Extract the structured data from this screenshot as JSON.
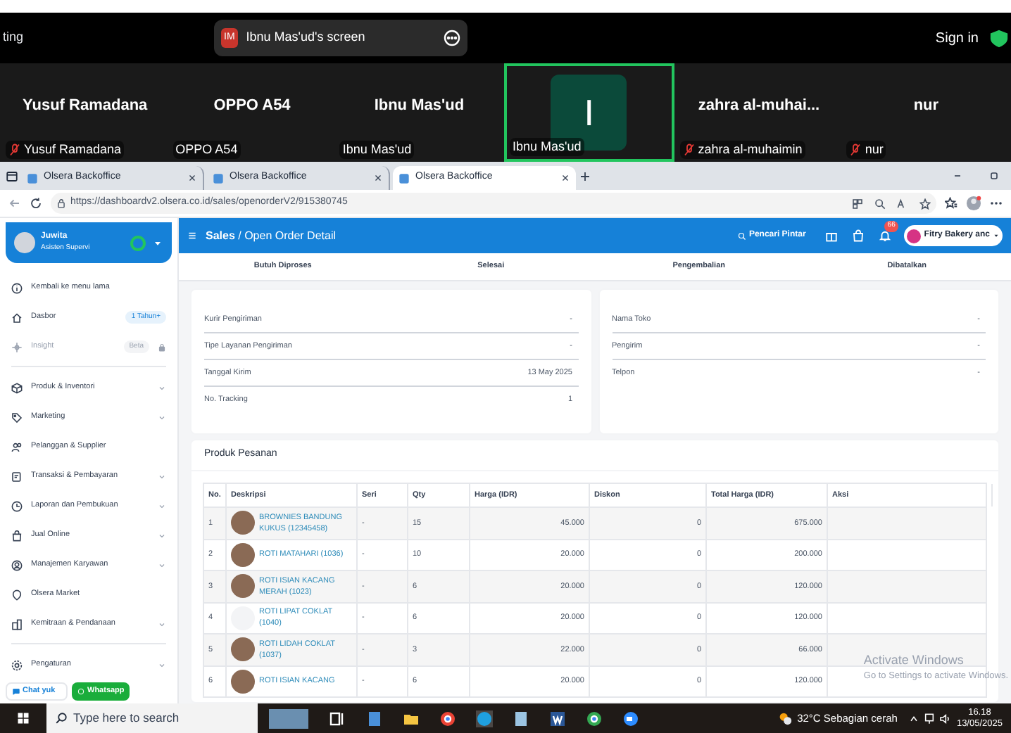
{
  "meeting_bar": {
    "left_text": "ting",
    "share_badge": "IM",
    "share_label": "Ibnu Mas'ud's screen",
    "sign_in": "Sign in"
  },
  "participants": [
    {
      "display_name": "Yusuf Ramadana",
      "label": "Yusuf Ramadana",
      "muted": true,
      "active_speaker": false
    },
    {
      "display_name": "OPPO A54",
      "label": "OPPO A54",
      "muted": false,
      "active_speaker": false
    },
    {
      "display_name": "Ibnu Mas'ud",
      "label": "Ibnu Mas'ud",
      "muted": false,
      "active_speaker": false
    },
    {
      "avatar": "I",
      "label": "Ibnu Mas'ud",
      "muted": false,
      "active_speaker": true
    },
    {
      "display_name": "zahra  al-muhai...",
      "label": "zahra al-muhaimin",
      "muted": true,
      "active_speaker": false
    },
    {
      "display_name": "nur",
      "label": "nur",
      "muted": true,
      "active_speaker": false
    }
  ],
  "browser": {
    "tabs": [
      {
        "title": "Olsera Backoffice",
        "selected": false
      },
      {
        "title": "Olsera Backoffice",
        "selected": false
      },
      {
        "title": "Olsera Backoffice",
        "selected": true
      }
    ],
    "url_host": "https://dashboardv2.olsera.co.id",
    "url_path": "/sales/openorderV2/915380745"
  },
  "sidebar": {
    "user": {
      "name": "Juwita",
      "role": "Asisten Supervi"
    },
    "items": [
      {
        "label": "Kembali ke menu lama",
        "has_submenu": false,
        "disabled": false
      },
      {
        "label": "Dasbor",
        "badge": "1 Tahun+",
        "has_submenu": false,
        "disabled": false
      },
      {
        "label": "Insight",
        "badge": "Beta",
        "has_submenu": false,
        "disabled": true
      },
      {
        "label": "Produk & Inventori",
        "has_submenu": true,
        "disabled": false
      },
      {
        "label": "Marketing",
        "has_submenu": true,
        "disabled": false
      },
      {
        "label": "Pelanggan & Supplier",
        "has_submenu": false,
        "disabled": false
      },
      {
        "label": "Transaksi & Pembayaran",
        "has_submenu": true,
        "disabled": false
      },
      {
        "label": "Laporan dan Pembukuan",
        "has_submenu": true,
        "disabled": false
      },
      {
        "label": "Jual Online",
        "has_submenu": true,
        "disabled": false
      },
      {
        "label": "Manajemen Karyawan",
        "has_submenu": true,
        "disabled": false
      },
      {
        "label": "Olsera Market",
        "has_submenu": false,
        "disabled": false
      },
      {
        "label": "Kemitraan & Pendanaan",
        "has_submenu": true,
        "disabled": false
      },
      {
        "label": "Pengaturan",
        "has_submenu": true,
        "disabled": false
      }
    ],
    "chat_button": "Chat yuk",
    "whatsapp_button": "Whatsapp"
  },
  "header": {
    "section": "Sales",
    "separator": "/",
    "page": "Open Order Detail",
    "search": "Pencari Pintar",
    "notification_count": "66",
    "store": "Fitry Bakery anc"
  },
  "status_tabs": [
    "Butuh Diproses",
    "Selesai",
    "Pengembalian",
    "Dibatalkan"
  ],
  "shipping_card": [
    {
      "label": "Kurir Pengiriman",
      "value": "-"
    },
    {
      "label": "Tipe Layanan Pengiriman",
      "value": "-"
    },
    {
      "label": "Tanggal Kirim",
      "value": "13 May 2025"
    },
    {
      "label": "No. Tracking",
      "value": "1"
    }
  ],
  "store_card": [
    {
      "label": "Nama Toko",
      "value": "-"
    },
    {
      "label": "Pengirim",
      "value": "-"
    },
    {
      "label": "Telpon",
      "value": "-"
    }
  ],
  "order_products": {
    "title": "Produk Pesanan",
    "columns": [
      "No.",
      "Deskripsi",
      "Seri",
      "Qty",
      "Harga (IDR)",
      "Diskon",
      "Total Harga (IDR)",
      "Aksi"
    ],
    "rows": [
      {
        "no": "1",
        "description": "BROWNIES BANDUNG KUKUS (12345458)",
        "seri": "-",
        "qty": "15",
        "price": "45.000",
        "discount": "0",
        "total": "675.000",
        "has_photo": true
      },
      {
        "no": "2",
        "description": "ROTI MATAHARI (1036)",
        "seri": "-",
        "qty": "10",
        "price": "20.000",
        "discount": "0",
        "total": "200.000",
        "has_photo": true
      },
      {
        "no": "3",
        "description": "ROTI ISIAN KACANG MERAH (1023)",
        "seri": "-",
        "qty": "6",
        "price": "20.000",
        "discount": "0",
        "total": "120.000",
        "has_photo": true
      },
      {
        "no": "4",
        "description": "ROTI LIPAT COKLAT (1040)",
        "seri": "-",
        "qty": "6",
        "price": "20.000",
        "discount": "0",
        "total": "120.000",
        "has_photo": false
      },
      {
        "no": "5",
        "description": "ROTI LIDAH COKLAT (1037)",
        "seri": "-",
        "qty": "3",
        "price": "22.000",
        "discount": "0",
        "total": "66.000",
        "has_photo": true
      },
      {
        "no": "6",
        "description": "ROTI ISIAN KACANG",
        "seri": "-",
        "qty": "6",
        "price": "20.000",
        "discount": "0",
        "total": "120.000",
        "has_photo": true
      }
    ]
  },
  "activation_notice": {
    "title": "Activate Windows",
    "text": "Go to Settings to activate Windows."
  },
  "taskbar": {
    "search_placeholder": "Type here to search",
    "weather": "32°C  Sebagian cerah",
    "time": "16.18",
    "date": "13/05/2025"
  }
}
